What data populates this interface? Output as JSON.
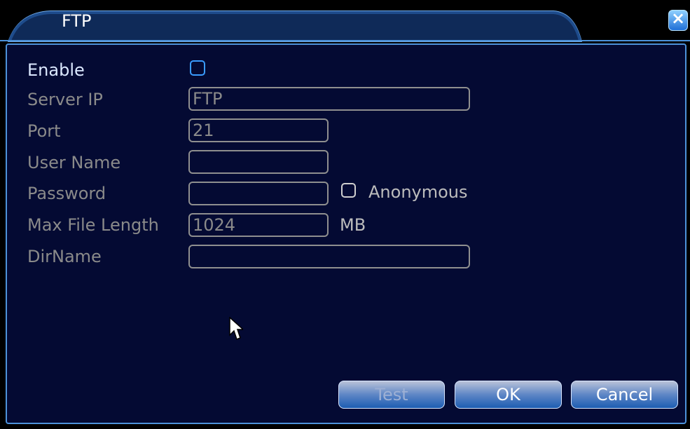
{
  "window": {
    "title": "FTP"
  },
  "form": {
    "enable_label": "Enable",
    "enable_checked": false,
    "server_ip_label": "Server IP",
    "server_ip_value": "FTP",
    "port_label": "Port",
    "port_value": "21",
    "user_name_label": "User Name",
    "user_name_value": "",
    "password_label": "Password",
    "password_value": "",
    "anonymous_label": "Anonymous",
    "anonymous_checked": false,
    "max_file_length_label": "Max File Length",
    "max_file_length_value": "1024",
    "max_file_length_unit": "MB",
    "dirname_label": "DirName",
    "dirname_value": ""
  },
  "buttons": {
    "test": "Test",
    "ok": "OK",
    "cancel": "Cancel"
  },
  "colors": {
    "panel": "#040a33",
    "border": "#4d92da",
    "accent": "#3a9cff"
  }
}
